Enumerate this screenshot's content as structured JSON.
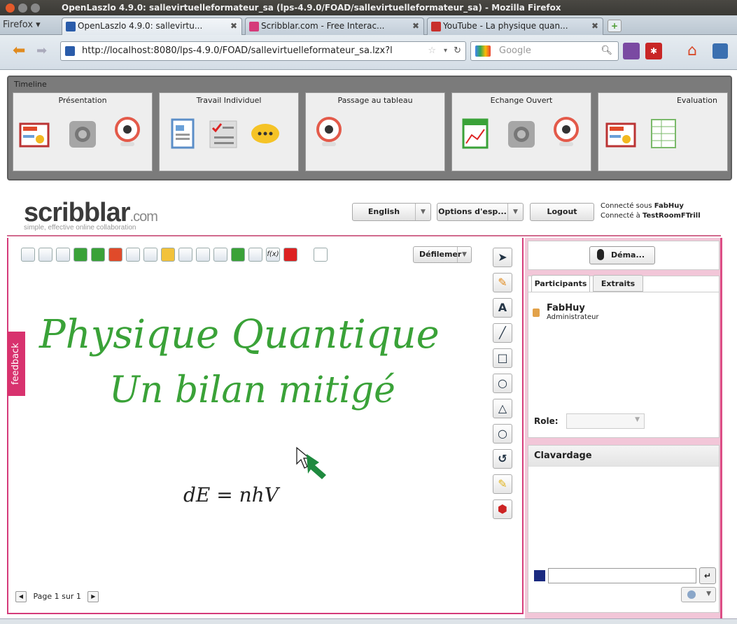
{
  "window": {
    "title": "OpenLaszlo 4.9.0: sallevirtuelleformateur_sa (lps-4.9.0/FOAD/sallevirtuelleformateur_sa) - Mozilla Firefox"
  },
  "browser": {
    "menu_label": "Firefox",
    "tabs": [
      {
        "label": "OpenLaszlo 4.9.0: sallevirtu...",
        "active": true
      },
      {
        "label": "Scribblar.com - Free Interac...",
        "active": false
      },
      {
        "label": "YouTube - La physique quan...",
        "active": false
      }
    ],
    "url": "http://localhost:8080/lps-4.9.0/FOAD/sallevirtuelleformateur_sa.lzx?l",
    "search_placeholder": "Google"
  },
  "timeline": {
    "label": "Timeline",
    "phases": [
      {
        "title": "Présentation"
      },
      {
        "title": "Travail Individuel"
      },
      {
        "title": "Passage au tableau"
      },
      {
        "title": "Echange Ouvert"
      },
      {
        "title": "Evaluation"
      }
    ]
  },
  "scribblar": {
    "brand": "scribblar",
    "brand_suffix": ".com",
    "tagline": "simple, effective online collaboration",
    "language": "English",
    "options": "Options d'esp...",
    "logout": "Logout",
    "connected_as_prefix": "Connecté sous ",
    "connected_user": "FabHuy",
    "connected_room_prefix": "Connecté à ",
    "connected_room": "TestRoomFTrill"
  },
  "whiteboard": {
    "scroll_mode": "Défilemer",
    "handwriting_line1": "Physique Quantique",
    "handwriting_line2": "Un bilan mitigé",
    "formula": "dE = nhV",
    "page_label": "Page 1 sur 1",
    "feedback": "feedback"
  },
  "right_panel": {
    "mic_button": "Déma...",
    "tabs": [
      "Participants",
      "Extraits"
    ],
    "participant_name": "FabHuy",
    "participant_role": "Administrateur",
    "role_label": "Role:",
    "chat_title": "Clavardage"
  },
  "colors": {
    "accent": "#d53b7a",
    "ink": "#3aa238"
  }
}
